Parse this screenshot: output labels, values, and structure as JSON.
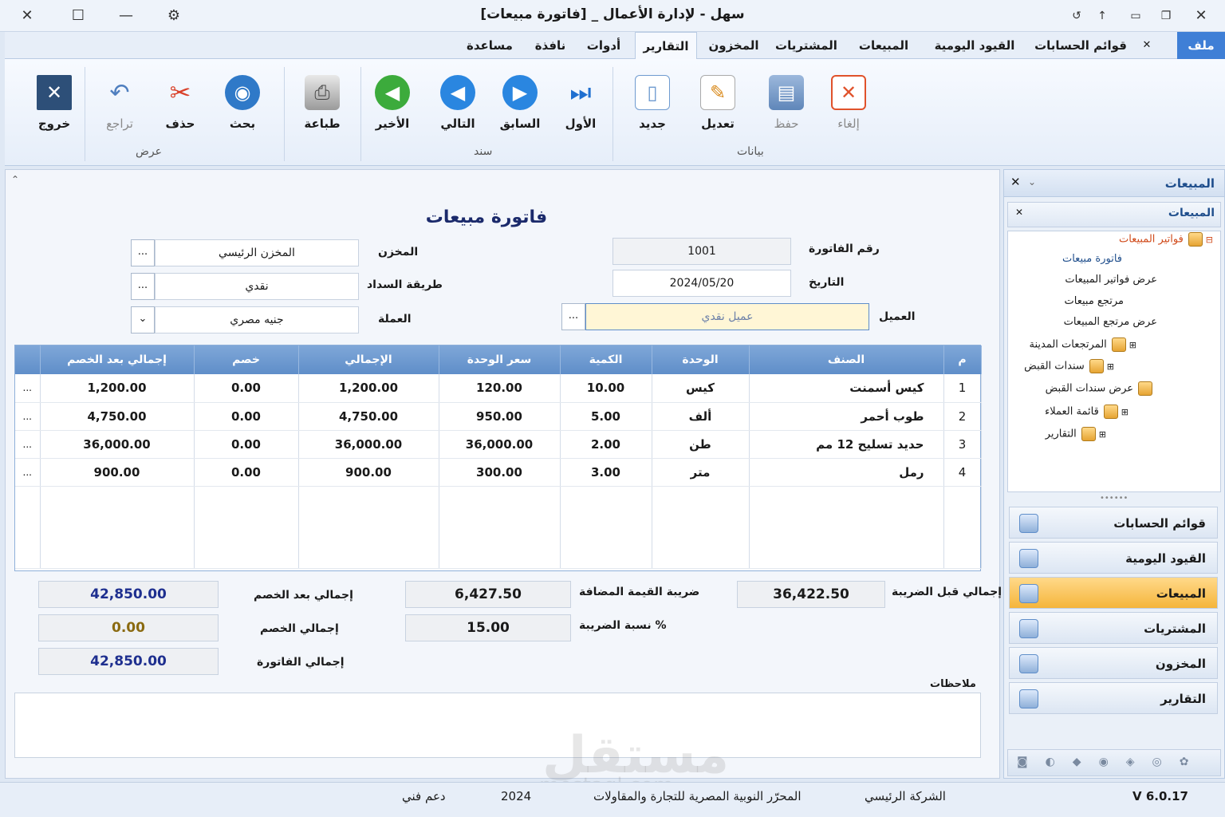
{
  "window": {
    "title": "سهل - لإدارة الأعمال _ [فاتورة مبيعات]"
  },
  "menu": {
    "file": "ملف",
    "tabs": [
      "قوائم الحسابات",
      "القيود اليومية",
      "المبيعات",
      "المشتريات",
      "المخزون",
      "التقارير",
      "أدوات",
      "نافذة",
      "مساعدة"
    ]
  },
  "ribbon": {
    "cancel": "إلغاء",
    "save": "حفظ",
    "edit": "تعديل",
    "new": "جديد",
    "first": "الأول",
    "previous": "السابق",
    "next": "التالي",
    "last": "الأخير",
    "print": "طباعة",
    "search": "بحث",
    "delete": "حذف",
    "undo": "تراجع",
    "exit": "خروج",
    "group_data": "بيانات",
    "group_doc": "سند",
    "group_view": "عرض"
  },
  "form": {
    "heading": "فاتورة مبيعات",
    "invoice_no_label": "رقم الفاتورة",
    "invoice_no": "1001",
    "date_label": "التاريخ",
    "date": "2024/05/20",
    "customer_label": "العميل",
    "customer": "عميل نقدي",
    "warehouse_label": "المخزن",
    "warehouse": "المخزن الرئيسي",
    "payment_label": "طريقة السداد",
    "payment": "نقدي",
    "currency_label": "العملة",
    "currency": "جنيه مصري",
    "dots": "..."
  },
  "grid": {
    "headers": [
      "م",
      "الصنف",
      "الوحدة",
      "الكمية",
      "سعر الوحدة",
      "الإجمالي",
      "خصم",
      "إجمالي بعد الخصم"
    ],
    "rows": [
      {
        "n": "1",
        "item": "كيس أسمنت",
        "unit": "كيس",
        "qty": "10.00",
        "price": "120.00",
        "total": "1,200.00",
        "disc": "0.00",
        "net": "1,200.00"
      },
      {
        "n": "2",
        "item": "طوب أحمر",
        "unit": "ألف",
        "qty": "5.00",
        "price": "950.00",
        "total": "4,750.00",
        "disc": "0.00",
        "net": "4,750.00"
      },
      {
        "n": "3",
        "item": "حديد تسليح 12 مم",
        "unit": "طن",
        "qty": "2.00",
        "price": "36,000.00",
        "total": "36,000.00",
        "disc": "0.00",
        "net": "36,000.00"
      },
      {
        "n": "4",
        "item": "رمل",
        "unit": "متر",
        "qty": "3.00",
        "price": "300.00",
        "total": "900.00",
        "disc": "0.00",
        "net": "900.00"
      }
    ]
  },
  "totals": {
    "before_tax_label": "إجمالي قبل الضريبة",
    "before_tax": "36,422.50",
    "vat_label": "ضريبة القيمة المضافة",
    "vat": "6,427.50",
    "tax_rate_label": "نسبة الضريبة %",
    "tax_rate": "15.00",
    "after_disc_label": "إجمالي بعد الخصم",
    "after_disc": "42,850.00",
    "disc_label": "إجمالي الخصم",
    "disc": "0.00",
    "invoice_total_label": "إجمالي الفاتورة",
    "invoice_total": "42,850.00",
    "notes_label": "ملاحظات"
  },
  "panel": {
    "title": "المبيعات",
    "subtitle": "المبيعات",
    "tree": [
      "فواتير المبيعات",
      "فاتورة مبيعات",
      "عرض فواتير المبيعات",
      "مرتجع مبيعات",
      "عرض مرتجع المبيعات",
      "المرتجعات المدينة",
      "سندات القبض",
      "عرض سندات القبض",
      "قائمة العملاء",
      "التقارير"
    ],
    "nav": [
      "قوائم الحسابات",
      "القيود اليومية",
      "المبيعات",
      "المشتريات",
      "المخزون",
      "التقارير"
    ]
  },
  "status": {
    "version": "V 6.0.17",
    "company": "الشركة الرئيسي",
    "customer_name": "المحرّر النوبية المصرية للتجارة والمقاولات",
    "year": "2024",
    "support": "دعم فني"
  },
  "watermark": {
    "brand": "مستقل",
    "site": "mostaql.com"
  },
  "colors": {
    "accent": "#3f7fd6",
    "grid_header": "#6e9bd1",
    "active_nav": "#f5b53b",
    "total_text": "#1e2f8f",
    "disc_text": "#8a6a10"
  }
}
